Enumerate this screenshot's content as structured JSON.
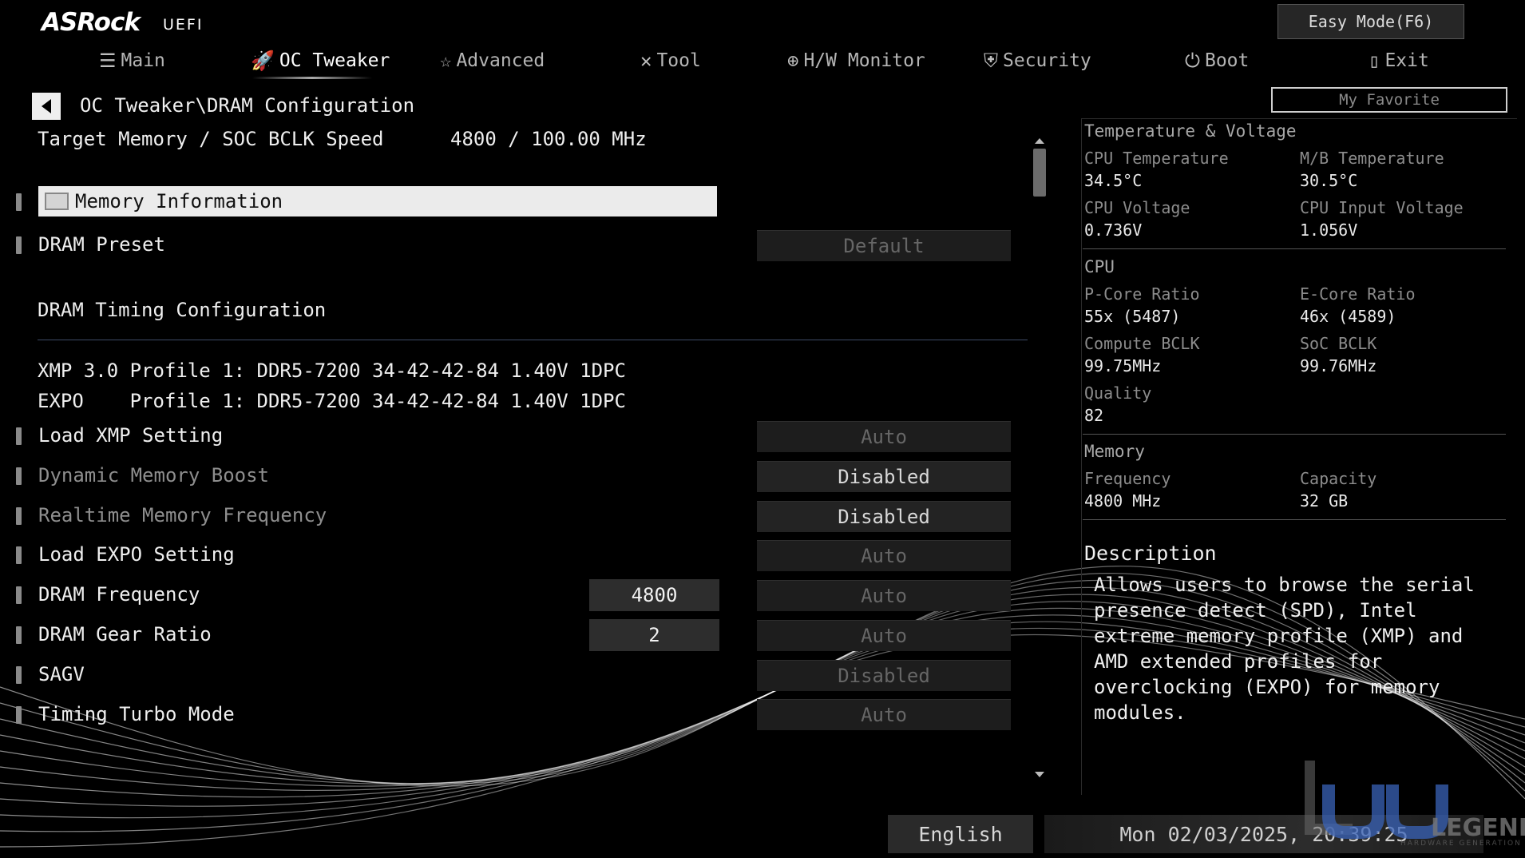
{
  "header": {
    "brand": "ASRock",
    "brand_sub": "UEFI",
    "easy_mode_label": "Easy Mode(F6)",
    "my_favorite_label": "My Favorite",
    "tabs": [
      {
        "label": "Main",
        "icon": "list-icon"
      },
      {
        "label": "OC Tweaker",
        "icon": "rocket-icon"
      },
      {
        "label": "Advanced",
        "icon": "star-icon"
      },
      {
        "label": "Tool",
        "icon": "tools-icon"
      },
      {
        "label": "H/W Monitor",
        "icon": "crosshair-icon"
      },
      {
        "label": "Security",
        "icon": "shield-icon"
      },
      {
        "label": "Boot",
        "icon": "power-icon"
      },
      {
        "label": "Exit",
        "icon": "exit-door-icon"
      }
    ],
    "active_tab": "OC Tweaker"
  },
  "breadcrumb": "OC Tweaker\\DRAM Configuration",
  "target": {
    "label": "Target Memory / SOC BCLK Speed",
    "value": "4800 / 100.00 MHz"
  },
  "memory_information": "Memory Information",
  "dram_preset": {
    "label": "DRAM Preset",
    "value": "Default"
  },
  "timing_section": "DRAM Timing Configuration",
  "profiles": {
    "xmp": "XMP 3.0 Profile 1: DDR5-7200 34-42-42-84 1.40V 1DPC",
    "expo": "EXPO    Profile 1: DDR5-7200 34-42-42-84 1.40V 1DPC"
  },
  "settings": [
    {
      "label": "Load XMP Setting",
      "value": "Auto",
      "dimmed": false,
      "value_active": false
    },
    {
      "label": "Dynamic Memory Boost",
      "value": "Disabled",
      "dimmed": true,
      "value_active": true
    },
    {
      "label": "Realtime Memory Frequency",
      "value": "Disabled",
      "dimmed": true,
      "value_active": true
    },
    {
      "label": "Load EXPO Setting",
      "value": "Auto",
      "dimmed": false,
      "value_active": false
    },
    {
      "label": "DRAM Frequency",
      "value": "Auto",
      "current": "4800",
      "dimmed": false,
      "value_active": false
    },
    {
      "label": "DRAM Gear Ratio",
      "value": "Auto",
      "current": "2",
      "dimmed": false,
      "value_active": false
    },
    {
      "label": "SAGV",
      "value": "Disabled",
      "dimmed": false,
      "value_active": false
    },
    {
      "label": "Timing Turbo Mode",
      "value": "Auto",
      "dimmed": false,
      "value_active": false
    }
  ],
  "monitor": {
    "temp_voltage_title": "Temperature & Voltage",
    "cpu_temp": {
      "label": "CPU Temperature",
      "value": "34.5°C"
    },
    "mb_temp": {
      "label": "M/B Temperature",
      "value": "30.5°C"
    },
    "cpu_voltage": {
      "label": "CPU Voltage",
      "value": "0.736V"
    },
    "cpu_input_voltage": {
      "label": "CPU Input Voltage",
      "value": "1.056V"
    },
    "cpu_title": "CPU",
    "pcore": {
      "label": "P-Core Ratio",
      "value": "55x (5487)"
    },
    "ecore": {
      "label": "E-Core Ratio",
      "value": "46x (4589)"
    },
    "compute_bclk": {
      "label": "Compute BCLK",
      "value": "99.75MHz"
    },
    "soc_bclk": {
      "label": "SoC BCLK",
      "value": "99.76MHz"
    },
    "quality": {
      "label": "Quality",
      "value": "82"
    },
    "memory_title": "Memory",
    "frequency": {
      "label": "Frequency",
      "value": "4800 MHz"
    },
    "capacity": {
      "label": "Capacity",
      "value": "32 GB"
    }
  },
  "description": {
    "title": "Description",
    "text": "Allows users to browse the serial presence detect (SPD), Intel extreme memory profile (XMP) and AMD extended profiles for overclocking (EXPO) for memory modules."
  },
  "footer": {
    "language": "English",
    "datetime": "Mon 02/03/2025, 20:39:25"
  },
  "watermark": {
    "text": "LEGEND",
    "sub": "HARDWARE GENERATION"
  }
}
